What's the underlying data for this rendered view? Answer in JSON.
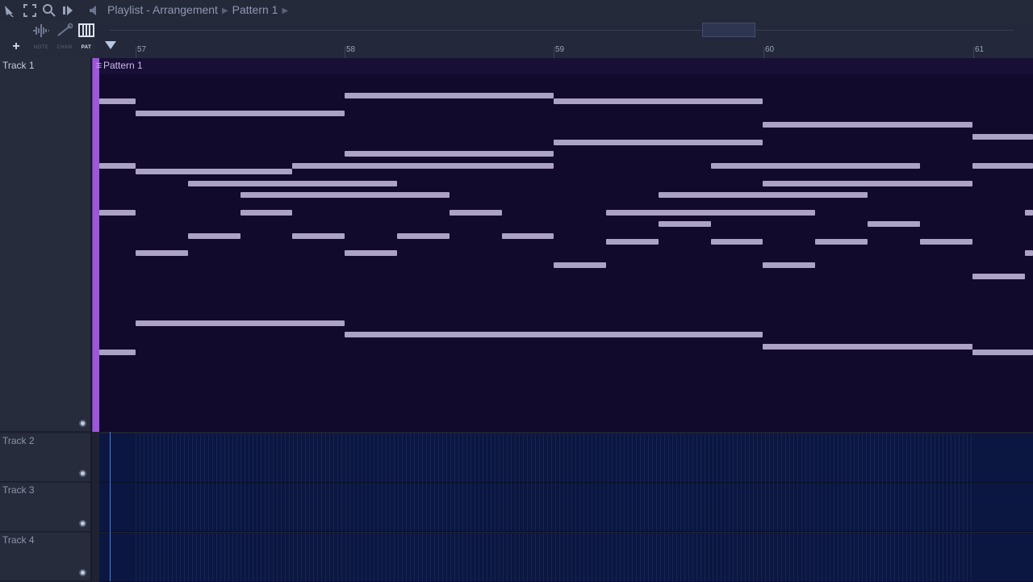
{
  "window": {
    "breadcrumb": [
      "Playlist - Arrangement",
      "Pattern 1"
    ]
  },
  "toolbar": {
    "add_label": "+",
    "modes": [
      {
        "name": "note-mode",
        "label": "NOTE"
      },
      {
        "name": "chan-mode",
        "label": "CHAN"
      },
      {
        "name": "pat-mode",
        "label": "PAT"
      }
    ]
  },
  "ruler": {
    "bars": [
      "57",
      "58",
      "59",
      "60",
      "61"
    ]
  },
  "tracks": [
    {
      "label": "Track 1"
    },
    {
      "label": "Track 2"
    },
    {
      "label": "Track 3"
    },
    {
      "label": "Track 4"
    }
  ],
  "pattern": {
    "title": "Pattern 1",
    "note_color": "#aca2c6",
    "background_color": "#110a2c",
    "accent_color": "#9b59d6"
  }
}
